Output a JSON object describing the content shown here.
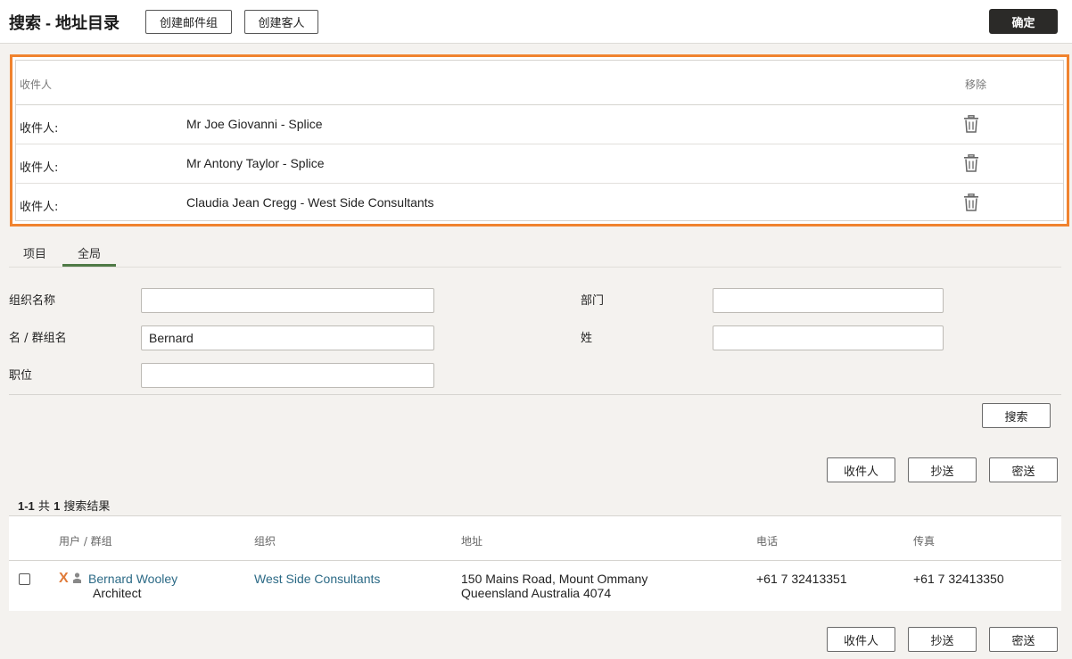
{
  "header": {
    "title": "搜索 - 地址目录",
    "create_group_label": "创建邮件组",
    "create_guest_label": "创建客人",
    "confirm_label": "确定"
  },
  "recipients": {
    "col_recipient": "收件人",
    "col_remove": "移除",
    "rows": [
      {
        "label": "收件人:",
        "name": "Mr Joe Giovanni - Splice"
      },
      {
        "label": "收件人:",
        "name": "Mr Antony Taylor - Splice"
      },
      {
        "label": "收件人:",
        "name": "Claudia Jean Cregg - West Side Consultants"
      }
    ]
  },
  "tabs": [
    {
      "label": "项目",
      "active": false
    },
    {
      "label": "全局",
      "active": true
    }
  ],
  "form": {
    "org_label": "组织名称",
    "org_value": "",
    "dept_label": "部门",
    "dept_value": "",
    "first_label": "名 / 群组名",
    "first_value": "Bernard",
    "last_label": "姓",
    "last_value": "",
    "position_label": "职位",
    "position_value": "",
    "search_label": "搜索"
  },
  "actions": {
    "to": "收件人",
    "cc": "抄送",
    "bcc": "密送"
  },
  "results": {
    "count_range": "1-1",
    "count_of": " 共 ",
    "count_total": "1",
    "count_suffix": " 搜索结果",
    "headers": {
      "user": "用户 / 群组",
      "org": "组织",
      "address": "地址",
      "phone": "电话",
      "fax": "传真"
    },
    "rows": [
      {
        "name": "Bernard Wooley",
        "title": "Architect",
        "org": "West Side Consultants",
        "address_line1": "150 Mains Road, Mount Ommany",
        "address_line2": "Queensland Australia 4074",
        "phone": "+61 7 32413351",
        "fax": "+61 7 32413350"
      }
    ]
  },
  "colors": {
    "highlight": "#f0832f",
    "link": "#2c6a86",
    "tab_active": "#4f7a46",
    "primary_button": "#2b2a28"
  }
}
